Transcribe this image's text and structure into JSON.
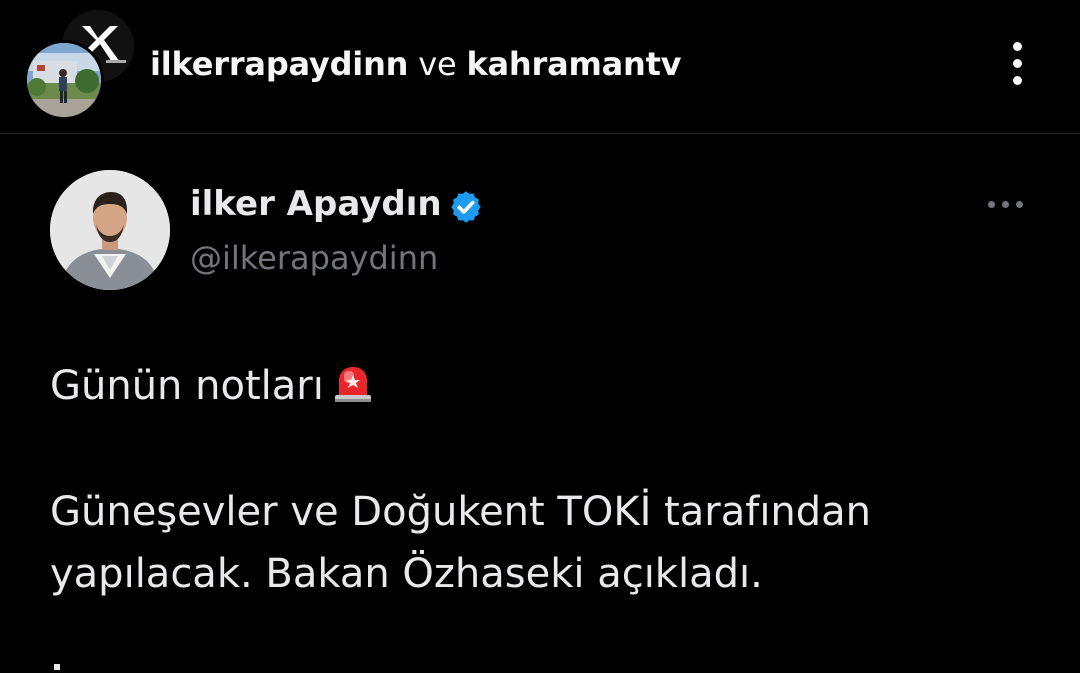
{
  "post_header": {
    "user1": "ilkerrapaydinn",
    "separator": "ve",
    "user2": "kahramantv",
    "more_icon": "more-vertical-icon"
  },
  "tweet": {
    "display_name": "ilker Apaydın",
    "handle": "@ilkerapaydinn",
    "verified": true,
    "verified_color": "#1d9bf0",
    "more_icon": "more-horizontal-icon",
    "text_line1": "Günün notları",
    "line1_emoji": "rotating-light-icon",
    "text_line2": "Güneşevler ve Doğukent TOKİ tarafından",
    "text_line3": "yapılacak. Bakan Özhaseki açıkladı."
  },
  "colors": {
    "background": "#000000",
    "primary_text": "#e7e9ea",
    "secondary_text": "#71767b",
    "divider": "#262626"
  }
}
